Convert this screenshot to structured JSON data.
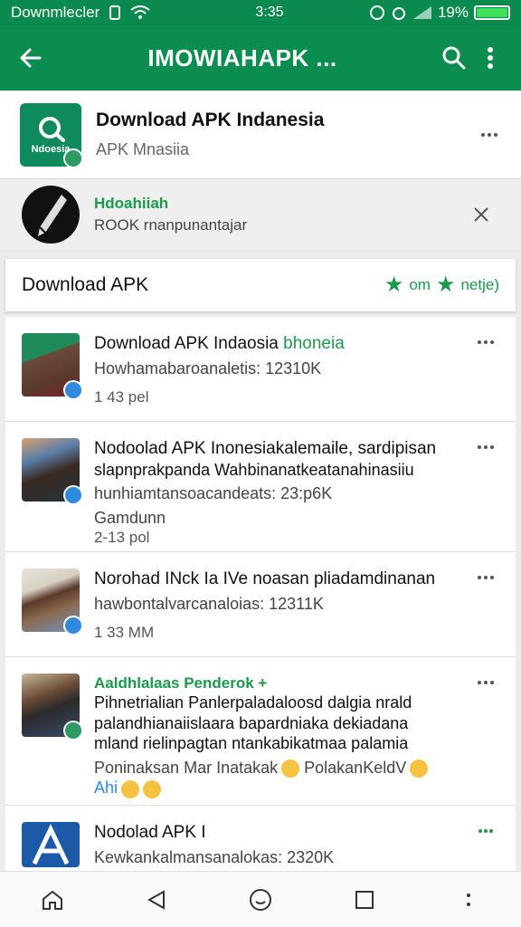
{
  "status": {
    "carrier": "Downmlecler",
    "time": "3:35",
    "battery": "19%"
  },
  "appbar": {
    "title": "IMOWIAHAPK ..."
  },
  "header": {
    "title": "Download APK Indanesia",
    "subtitle": "APK Mnasiia",
    "logo_text": "Ndoesia"
  },
  "notice": {
    "name": "Hdoahiiah",
    "text": "ROOK rnanpunantajar"
  },
  "tab": {
    "title": "Download APK",
    "rating1": "om",
    "rating2": "netje)"
  },
  "posts": [
    {
      "title": "Download APK Indaosia",
      "title_hi": "bhoneia",
      "line1": "Howhamabaroanaletis: 12310K",
      "time": "1 43 pel"
    },
    {
      "title": "Nodoolad APK Inonesiakalemaile, sardipisan",
      "line1": "slapnprakpanda Wahbinanatkeatanahinasiiu",
      "line2": "hunhiamtansoacandeats: 23:p6K",
      "line3": "Gamdunn",
      "time": "2-13 pol"
    },
    {
      "title": "Norohad INck Ia IVe",
      "title_rest": "noasan pliadamdinanan",
      "line1": "hawbontalvarcanaloias: 12311K",
      "time": "1 33 MM"
    },
    {
      "title_green": "Aaldhlalaas Penderok +",
      "line1": "Pihnetrialian Panlerpaladaloosd dalgia nrald",
      "line2": "palandhianaiislaara bapardniaka dekiadana",
      "line3": "mland rielinpagtan ntankabikatmaa palamia",
      "line4": "Poninaksan Mar Inatakak",
      "line4b": "PolakanKeldV",
      "line5": "Ahi"
    },
    {
      "title": "Nodolad APK I",
      "line1": "Kewkankalmansanalokas: 2320K"
    }
  ],
  "colors": {
    "primary": "#0b8d50",
    "accent": "#1a9a4a"
  }
}
